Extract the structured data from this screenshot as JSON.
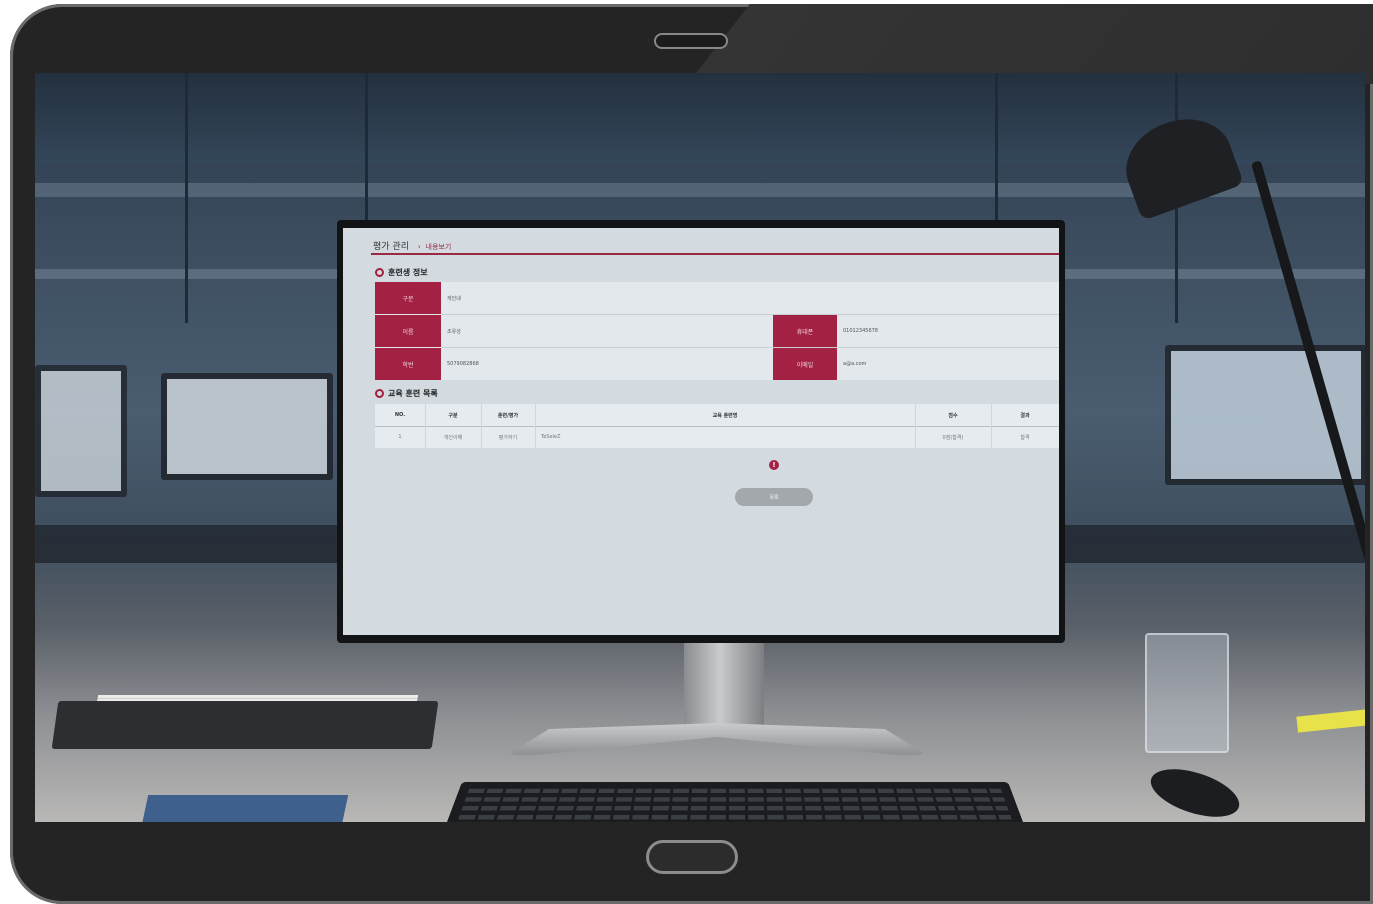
{
  "app": {
    "breadcrumb": {
      "title": "평가 관리",
      "separator": "›",
      "current": "내용보기"
    }
  },
  "trainee_info": {
    "section_title": "훈련생 정보",
    "fields_left": [
      {
        "label": "구분",
        "value": "개인내"
      },
      {
        "label": "이름",
        "value": "조유성"
      },
      {
        "label": "학번",
        "value": "5079082868"
      }
    ],
    "fields_right": [
      {
        "label": "휴대폰",
        "value": "01012345678"
      },
      {
        "label": "이메일",
        "value": "a@a.com"
      }
    ]
  },
  "training_list": {
    "section_title": "교육 훈련 목록",
    "columns": [
      "NO.",
      "구분",
      "훈련/평가",
      "교육 훈련명",
      "점수",
      "결과"
    ],
    "rows": [
      [
        "1",
        "개인이해",
        "평가하기",
        "TeSeleZ",
        "0점(합격)",
        "합격"
      ]
    ]
  },
  "alert_icon": "!",
  "list_button": "목록",
  "icons": [
    "circle-bullet-icon",
    "alert-icon",
    "speaker-slot-icon",
    "home-button-icon"
  ],
  "colors": {
    "accent": "#a32244",
    "screen_bg": "#d3dae0",
    "tablet_frame": "#242424"
  }
}
